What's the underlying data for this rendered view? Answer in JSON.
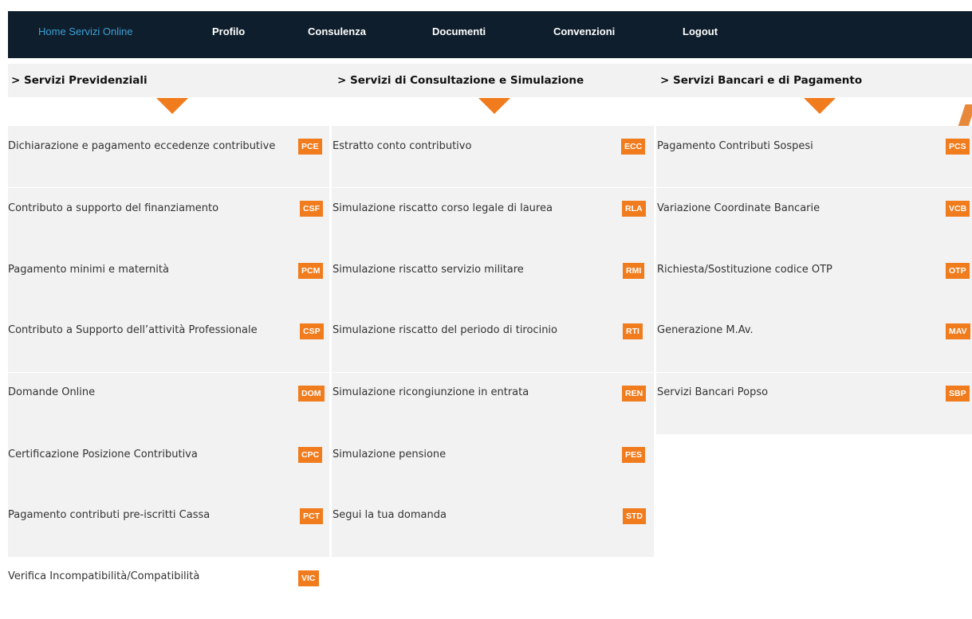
{
  "nav": {
    "items": [
      {
        "label": "Home Servizi Online",
        "active": true
      },
      {
        "label": "Profilo"
      },
      {
        "label": "Consulenza"
      },
      {
        "label": "Documenti"
      },
      {
        "label": "Convenzioni"
      },
      {
        "label": "Logout"
      }
    ]
  },
  "columns": [
    {
      "title": "> Servizi Previdenziali",
      "items": [
        {
          "label": "Dichiarazione e pagamento eccedenze contributive",
          "code": "PCE"
        },
        {
          "label": "Contributo a supporto del finanziamento",
          "code": "CSF"
        },
        {
          "label": "Pagamento minimi e maternità",
          "code": "PCM"
        },
        {
          "label": "Contributo a Supporto dell’attività Professionale",
          "code": "CSP"
        },
        {
          "label": "Domande Online",
          "code": "DOM"
        },
        {
          "label": "Certificazione Posizione Contributiva",
          "code": "CPC"
        },
        {
          "label": "Pagamento contributi pre-iscritti Cassa",
          "code": "PCT"
        },
        {
          "label": "Verifica Incompatibilità/Compatibilità",
          "code": "VIC"
        }
      ]
    },
    {
      "title": "> Servizi di Consultazione e Simulazione",
      "items": [
        {
          "label": "Estratto conto contributivo",
          "code": "ECC"
        },
        {
          "label": "Simulazione riscatto corso legale di laurea",
          "code": "RLA"
        },
        {
          "label": "Simulazione riscatto servizio militare",
          "code": "RMI"
        },
        {
          "label": "Simulazione riscatto del periodo di tirocinio",
          "code": "RTI"
        },
        {
          "label": "Simulazione ricongiunzione in entrata",
          "code": "REN"
        },
        {
          "label": "Simulazione pensione",
          "code": "PES"
        },
        {
          "label": "Segui la tua domanda",
          "code": "STD"
        }
      ]
    },
    {
      "title": "> Servizi Bancari e di Pagamento",
      "items": [
        {
          "label": "Pagamento Contributi Sospesi",
          "code": "PCS"
        },
        {
          "label": "Variazione Coordinate Bancarie",
          "code": "VCB"
        },
        {
          "label": "Richiesta/Sostituzione codice OTP",
          "code": "OTP"
        },
        {
          "label": "Generazione M.Av.",
          "code": "MAV"
        },
        {
          "label": "Servizi Bancari Popso",
          "code": "SBP"
        }
      ]
    }
  ],
  "colors": {
    "nav_bg": "#0f1e2c",
    "nav_active": "#3aa0d6",
    "accent": "#f07c1e",
    "row_bg": "#f2f2f2"
  },
  "icons": {
    "column_indicator": "triangle-down-icon",
    "scroll": "scroll-thumb-icon"
  }
}
